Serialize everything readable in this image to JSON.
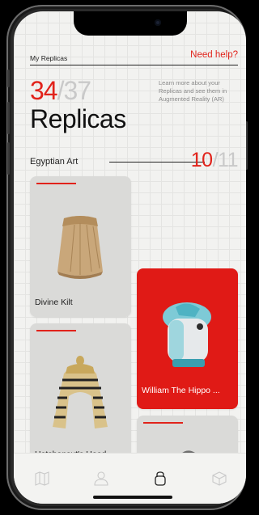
{
  "header": {
    "title": "My Replicas",
    "help_link": "Need help?"
  },
  "summary": {
    "owned": "34",
    "total": "/37",
    "label": "Replicas",
    "info": "Learn more about your Replicas and see them in Augmented Reality (AR)"
  },
  "section": {
    "label": "Egyptian Art",
    "owned": "10",
    "total": "/11"
  },
  "cards": [
    {
      "name": "Divine Kilt",
      "highlighted": false
    },
    {
      "name": "William The Hippo ...",
      "highlighted": true
    },
    {
      "name": "Hatshepsut's Head...",
      "highlighted": false
    },
    {
      "name": "",
      "highlighted": false
    }
  ],
  "tabs": [
    {
      "icon": "map-icon",
      "active": false
    },
    {
      "icon": "profile-icon",
      "active": false
    },
    {
      "icon": "replicas-bag-icon",
      "active": true
    },
    {
      "icon": "ar-cube-icon",
      "active": false
    }
  ],
  "colors": {
    "accent": "#e1231b",
    "muted": "#c9c9c9",
    "card": "#dadad8",
    "highlight_card": "#e01a16"
  }
}
